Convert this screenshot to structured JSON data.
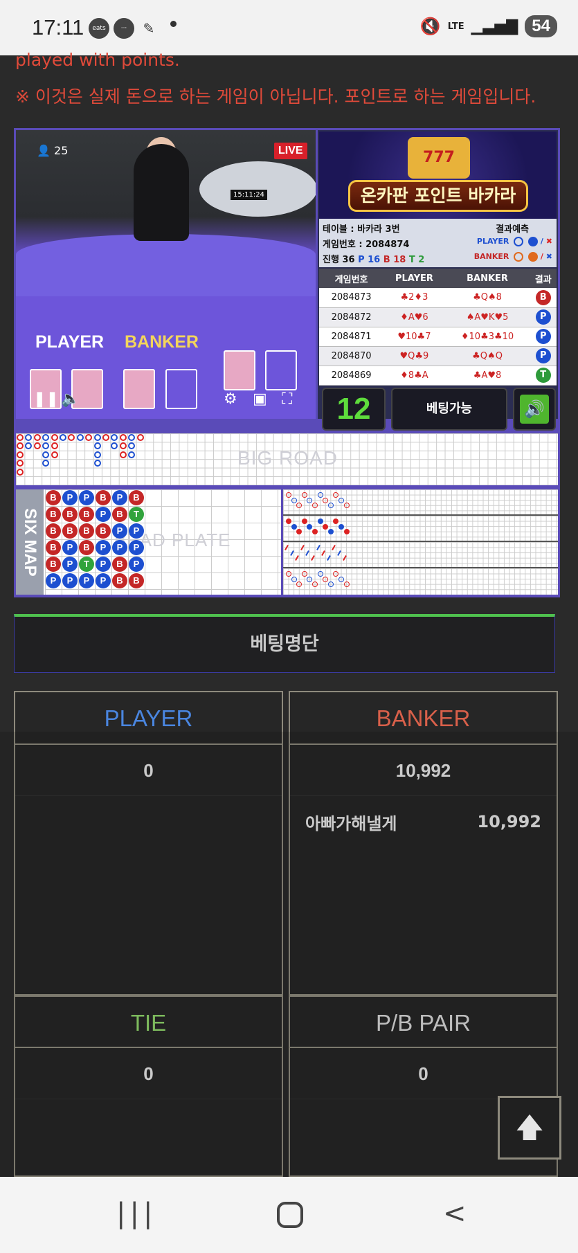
{
  "status_bar": {
    "time": "17:11",
    "app_badge": "coupang eats",
    "battery": "54",
    "network": "LTE"
  },
  "notice": {
    "english_partial": "played with points.",
    "korean": "※ 이것은 실제 돈으로 하는 게임이 아닙니다. 포인트로 하는 게임입니다."
  },
  "video": {
    "viewers": "25",
    "live_label": "LIVE",
    "timer": "15:11:24",
    "player_label": "PLAYER",
    "banker_label": "BANKER"
  },
  "banner": {
    "title": "온카판 포인트 바카라",
    "slot": "777"
  },
  "table_info": {
    "table": "테이블 : 바카라 3번",
    "prediction_label": "결과예측",
    "game_number": "게임번호 : 2084874",
    "progress": "진행 36",
    "p_count": "P 16",
    "b_count": "B 18",
    "t_count": "T 2",
    "player_label": "PLAYER",
    "banker_label": "BANKER"
  },
  "history": {
    "headers": [
      "게임번호",
      "PLAYER",
      "BANKER",
      "결과"
    ],
    "rows": [
      {
        "no": "2084873",
        "player": "♣2♦3",
        "banker": "♣Q♠8",
        "result": "B"
      },
      {
        "no": "2084872",
        "player": "♦A♥6",
        "banker": "♠A♥K♥5",
        "result": "P"
      },
      {
        "no": "2084871",
        "player": "♥10♣7",
        "banker": "♦10♣3♣10",
        "result": "P"
      },
      {
        "no": "2084870",
        "player": "♥Q♣9",
        "banker": "♣Q♠Q",
        "result": "P"
      },
      {
        "no": "2084869",
        "player": "♦8♣A",
        "banker": "♣A♥8",
        "result": "T"
      }
    ]
  },
  "controls": {
    "countdown": "12",
    "bet_state": "베팅가능"
  },
  "roads": {
    "big_road_label": "BIG ROAD",
    "six_map_label": "SIX MAP",
    "bead_plate_label": "BEAD PLATE",
    "bead_columns": [
      [
        "B",
        "B",
        "B",
        "B",
        "B",
        "P"
      ],
      [
        "P",
        "B",
        "B",
        "P",
        "P",
        "P"
      ],
      [
        "P",
        "B",
        "B",
        "B",
        "T",
        "P"
      ],
      [
        "B",
        "P",
        "B",
        "P",
        "P",
        "P"
      ],
      [
        "P",
        "B",
        "P",
        "P",
        "B",
        "B"
      ],
      [
        "B",
        "T",
        "P",
        "P",
        "P",
        "B"
      ]
    ]
  },
  "betting": {
    "title": "베팅명단",
    "player": {
      "label": "PLAYER",
      "total": "0"
    },
    "banker": {
      "label": "BANKER",
      "total": "10,992",
      "entries": [
        {
          "name": "아빠가해낼게",
          "amount": "10,992"
        }
      ]
    },
    "tie": {
      "label": "TIE",
      "total": "0"
    },
    "pair": {
      "label": "P/B PAIR",
      "total": "0"
    }
  },
  "colors": {
    "player": "#4a86e0",
    "banker": "#d9604a",
    "tie": "#8fd46a",
    "pair": "#d8d8d8",
    "accent": "#4fc14e"
  }
}
